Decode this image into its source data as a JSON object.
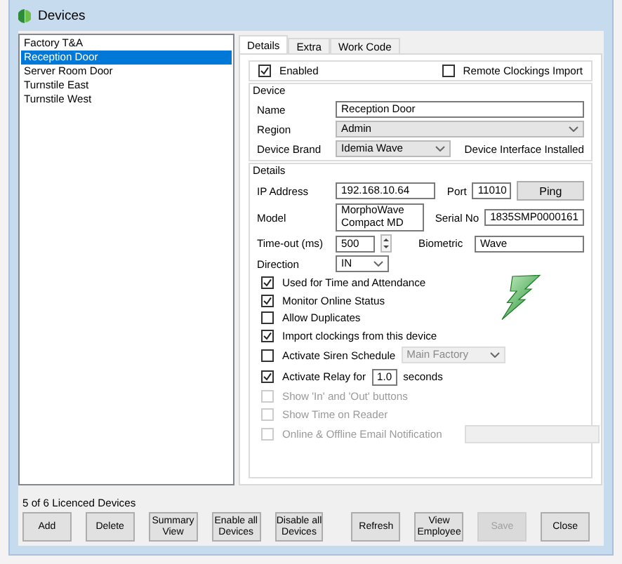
{
  "window": {
    "title": "Devices"
  },
  "device_list": [
    {
      "label": "Factory T&A",
      "selected": false
    },
    {
      "label": "Reception Door",
      "selected": true
    },
    {
      "label": "Server Room Door",
      "selected": false
    },
    {
      "label": "Turnstile East",
      "selected": false
    },
    {
      "label": "Turnstile West",
      "selected": false
    }
  ],
  "tabs": [
    {
      "label": "Details",
      "selected": true
    },
    {
      "label": "Extra",
      "selected": false
    },
    {
      "label": "Work Code",
      "selected": false
    }
  ],
  "enabled": {
    "label": "Enabled",
    "checked": true
  },
  "remote_clockings_import": {
    "label": "Remote Clockings Import",
    "checked": false
  },
  "device_group": {
    "title": "Device",
    "name": {
      "label": "Name",
      "value": "Reception Door"
    },
    "region": {
      "label": "Region",
      "value": "Admin"
    },
    "device_brand": {
      "label": "Device Brand",
      "value": "Idemia Wave"
    },
    "status": "Device Interface Installed"
  },
  "details_group": {
    "title": "Details",
    "ip_address": {
      "label": "IP Address",
      "value": "192.168.10.64"
    },
    "port": {
      "label": "Port",
      "value": "11010"
    },
    "ping_button": "Ping",
    "model": {
      "label": "Model",
      "value": "MorphoWave Compact MD"
    },
    "serial_no": {
      "label": "Serial No",
      "value": "1835SMP0000161"
    },
    "timeout": {
      "label": "Time-out (ms)",
      "value": "500"
    },
    "biometric": {
      "label": "Biometric",
      "value": "Wave"
    },
    "direction": {
      "label": "Direction",
      "value": "IN"
    }
  },
  "options": [
    {
      "kind": "check",
      "label": "Used for Time and Attendance",
      "checked": true,
      "disabled": false
    },
    {
      "kind": "check",
      "label": "Monitor Online Status",
      "checked": true,
      "disabled": false
    },
    {
      "kind": "check",
      "label": "Allow Duplicates",
      "checked": false,
      "disabled": false
    },
    {
      "kind": "check",
      "label": "Import clockings from this device",
      "checked": true,
      "disabled": false
    },
    {
      "kind": "select",
      "label": "Activate Siren Schedule",
      "checked": false,
      "disabled": false,
      "value": "Main Factory"
    },
    {
      "kind": "relay",
      "label": "Activate Relay for",
      "checked": true,
      "disabled": false,
      "value": "1.0",
      "suffix": "seconds"
    },
    {
      "kind": "check",
      "label": "Show 'In' and 'Out' buttons",
      "checked": false,
      "disabled": true
    },
    {
      "kind": "check",
      "label": "Show Time on Reader",
      "checked": false,
      "disabled": true
    },
    {
      "kind": "field",
      "label": "Online & Offline Email Notification",
      "checked": false,
      "disabled": true
    }
  ],
  "license_count": "5 of 6 Licenced Devices",
  "buttons_left": [
    {
      "label": "Add",
      "disabled": false
    },
    {
      "label": "Delete",
      "disabled": false
    },
    {
      "label": "Summary View",
      "disabled": false
    },
    {
      "label": "Enable all Devices",
      "disabled": false
    },
    {
      "label": "Disable all Devices",
      "disabled": false
    }
  ],
  "buttons_right": [
    {
      "label": "Refresh",
      "disabled": false
    },
    {
      "label": "View Employee",
      "disabled": false
    },
    {
      "label": "Save",
      "disabled": true
    },
    {
      "label": "Close",
      "disabled": false
    }
  ]
}
